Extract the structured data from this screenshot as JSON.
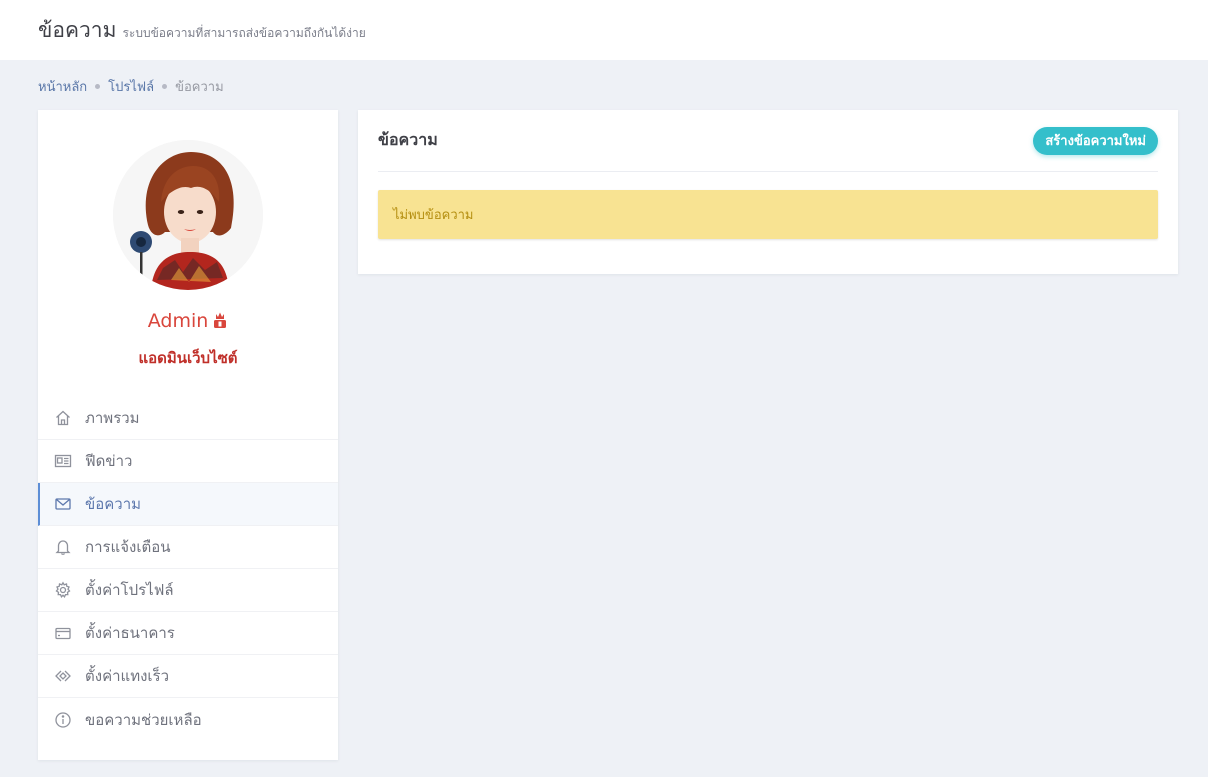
{
  "header": {
    "title": "ข้อความ",
    "subtitle": "ระบบข้อความที่สามารถส่งข้อความถึงกันได้ง่าย"
  },
  "breadcrumb": [
    {
      "label": "หน้าหลัก"
    },
    {
      "label": "โปรไฟล์"
    },
    {
      "label": "ข้อความ"
    }
  ],
  "profile": {
    "name": "Admin",
    "role": "แอดมินเว็บไซต์",
    "name_color": "#d9463c",
    "crown_icon": "crown-icon"
  },
  "menu": [
    {
      "label": "ภาพรวม",
      "icon": "home-icon",
      "active": false
    },
    {
      "label": "ฟีดข่าว",
      "icon": "newspaper-icon",
      "active": false
    },
    {
      "label": "ข้อความ",
      "icon": "envelope-icon",
      "active": true
    },
    {
      "label": "การแจ้งเตือน",
      "icon": "bell-icon",
      "active": false
    },
    {
      "label": "ตั้งค่าโปรไฟล์",
      "icon": "gear-icon",
      "active": false
    },
    {
      "label": "ตั้งค่าธนาคาร",
      "icon": "wallet-icon",
      "active": false
    },
    {
      "label": "ตั้งค่าแทงเร็ว",
      "icon": "diamond-arrows-icon",
      "active": false
    },
    {
      "label": "ขอความช่วยเหลือ",
      "icon": "info-icon",
      "active": false
    }
  ],
  "messages": {
    "title": "ข้อความ",
    "new_button": "สร้างข้อความใหม่",
    "empty_text": "ไม่พบข้อความ"
  },
  "colors": {
    "accent": "#34bfcb",
    "active_menu": "#5d8ed6",
    "alert_bg": "#f8e392",
    "alert_text": "#b58f11"
  }
}
